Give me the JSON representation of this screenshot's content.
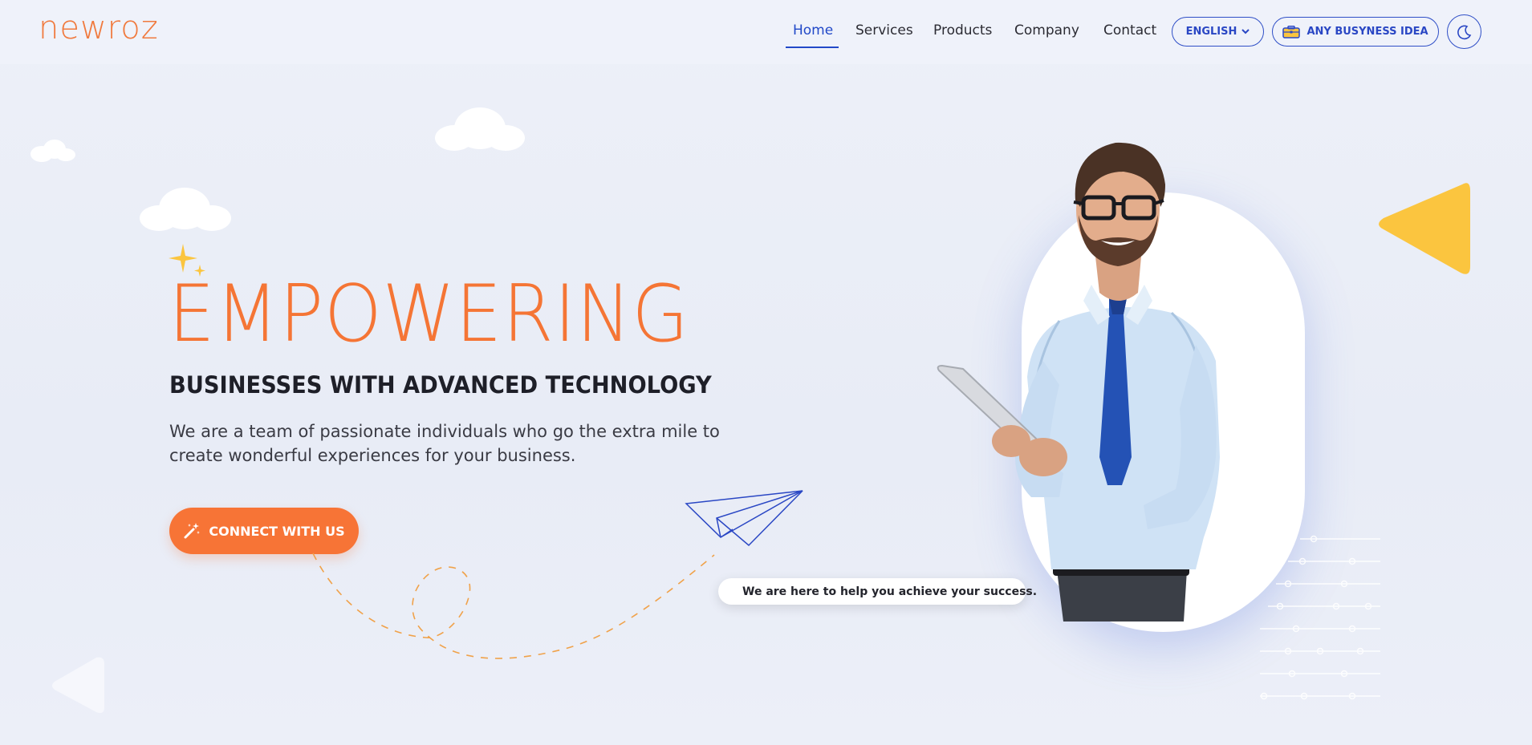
{
  "header": {
    "logo": "newroz",
    "nav": [
      {
        "label": "Home",
        "active": true
      },
      {
        "label": "Services",
        "active": false
      },
      {
        "label": "Products",
        "active": false
      },
      {
        "label": "Company",
        "active": false
      },
      {
        "label": "Contact",
        "active": false
      }
    ],
    "language_label": "ENGLISH",
    "idea_label": "ANY BUSYNESS IDEA",
    "theme_icon": "moon-icon"
  },
  "hero": {
    "title": "EMPOWERING",
    "subtitle": "BUSINESSES WITH ADVANCED TECHNOLOGY",
    "description": "We are a team of passionate individuals who go the extra mile to create wonderful experiences for your business.",
    "cta_label": "CONNECT WITH US",
    "status_text": "We are here to help you achieve your success."
  },
  "colors": {
    "accent_orange": "#f57535",
    "accent_blue": "#2249c8",
    "yellow": "#fbc53f",
    "status_green": "#3ad34a"
  },
  "icons": [
    "chevron-down-icon",
    "briefcase-icon",
    "moon-icon",
    "magic-wand-icon",
    "paper-plane-icon",
    "sparkle-icon"
  ]
}
